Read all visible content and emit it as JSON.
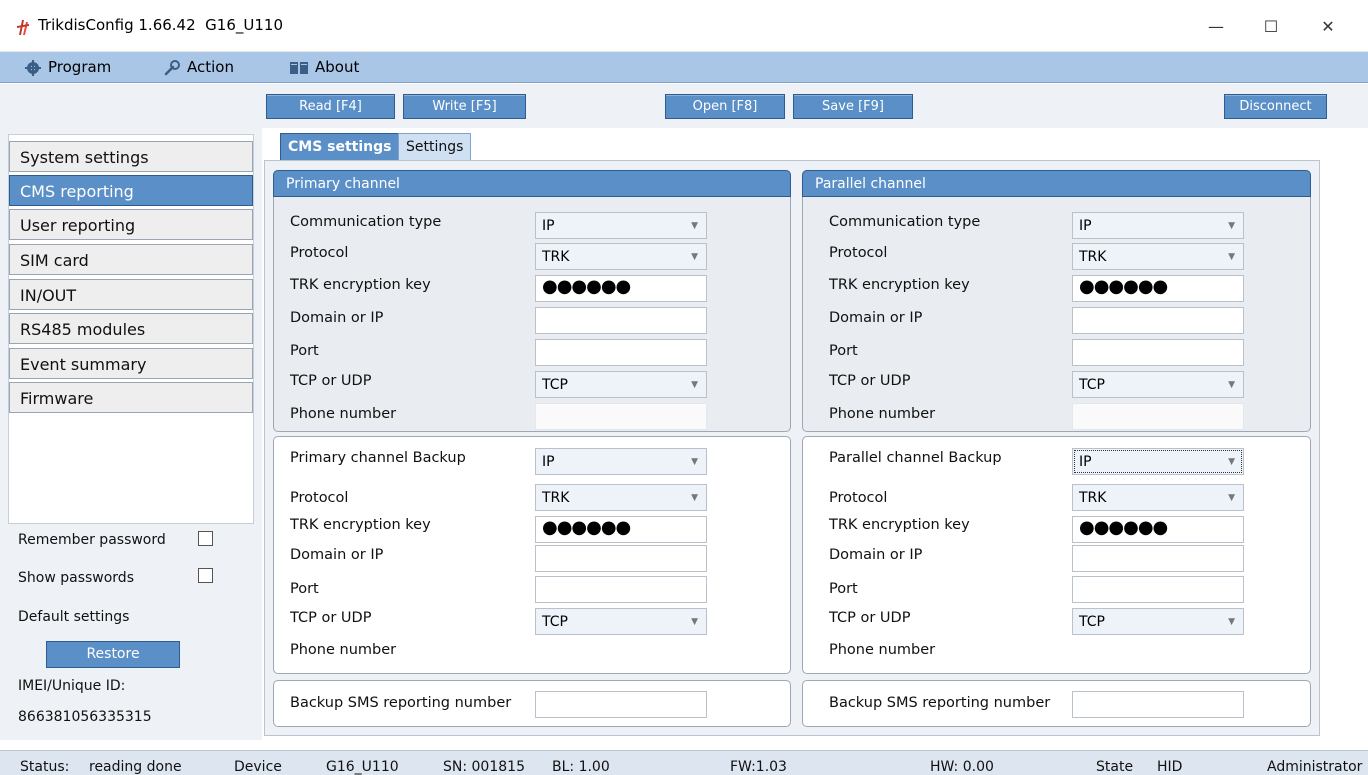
{
  "window": {
    "title": "TrikdisConfig 1.66.42  G16_U110",
    "minimize": "—",
    "maximize": "☐",
    "close": "✕"
  },
  "menu": {
    "program": "Program",
    "action": "Action",
    "about": "About"
  },
  "toolbar": {
    "read": "Read [F4]",
    "write": "Write [F5]",
    "open": "Open [F8]",
    "save": "Save [F9]",
    "disconnect": "Disconnect"
  },
  "sidebar": {
    "items": [
      {
        "label": "System settings"
      },
      {
        "label": "CMS reporting"
      },
      {
        "label": "User reporting"
      },
      {
        "label": "SIM card"
      },
      {
        "label": "IN/OUT"
      },
      {
        "label": "RS485 modules"
      },
      {
        "label": "Event summary"
      },
      {
        "label": "Firmware"
      }
    ],
    "active_index": 1,
    "remember_password": "Remember password",
    "show_passwords": "Show passwords",
    "default_settings": "Default settings",
    "restore": "Restore",
    "imei_label": "IMEI/Unique ID:",
    "imei_value": "866381056335315"
  },
  "tabs": {
    "cms_settings": "CMS settings",
    "settings": "Settings"
  },
  "primary": {
    "header": "Primary channel",
    "comm_type_label": "Communication type",
    "comm_type_value": "IP",
    "protocol_label": "Protocol",
    "protocol_value": "TRK",
    "key_label": "TRK encryption key",
    "key_value": "●●●●●●",
    "domain_label": "Domain or IP",
    "domain_value": "",
    "port_label": "Port",
    "port_value": "",
    "tcpudp_label": "TCP or UDP",
    "tcpudp_value": "TCP",
    "phone_label": "Phone number",
    "phone_value": ""
  },
  "parallel": {
    "header": "Parallel channel",
    "comm_type_label": "Communication type",
    "comm_type_value": "IP",
    "protocol_label": "Protocol",
    "protocol_value": "TRK",
    "key_label": "TRK encryption key",
    "key_value": "●●●●●●",
    "domain_label": "Domain or IP",
    "domain_value": "",
    "port_label": "Port",
    "port_value": "",
    "tcpudp_label": "TCP or UDP",
    "tcpudp_value": "TCP",
    "phone_label": "Phone number",
    "phone_value": ""
  },
  "primary_backup": {
    "backup_label": "Primary channel Backup",
    "backup_value": "IP",
    "protocol_label": "Protocol",
    "protocol_value": "TRK",
    "key_label": "TRK encryption key",
    "key_value": "●●●●●●",
    "domain_label": "Domain or IP",
    "domain_value": "",
    "port_label": "Port",
    "port_value": "",
    "tcpudp_label": "TCP or UDP",
    "tcpudp_value": "TCP",
    "phone_label": "Phone number"
  },
  "parallel_backup": {
    "backup_label": "Parallel channel Backup",
    "backup_value": "IP",
    "protocol_label": "Protocol",
    "protocol_value": "TRK",
    "key_label": "TRK encryption key",
    "key_value": "●●●●●●",
    "domain_label": "Domain or IP",
    "domain_value": "",
    "port_label": "Port",
    "port_value": "",
    "tcpudp_label": "TCP or UDP",
    "tcpudp_value": "TCP",
    "phone_label": "Phone number"
  },
  "sms": {
    "left_label": "Backup SMS reporting number",
    "left_value": "",
    "right_label": "Backup SMS reporting number",
    "right_value": ""
  },
  "status": {
    "status_label": "Status:",
    "status_value": "reading done",
    "device_label": "Device",
    "device_value": "G16_U110",
    "sn": "SN: 001815",
    "bl": "BL: 1.00",
    "fw": "FW:1.03",
    "hw": "HW:  0.00",
    "state_label": "State",
    "state_value": "HID",
    "role": "Administrator"
  },
  "colors": {
    "accent": "#5b8fc7",
    "menubar": "#a9c6e6",
    "panel": "#eef2f7"
  },
  "icons": {
    "app": "trikdis-logo-icon",
    "program": "gear-icon",
    "action": "wrench-icon",
    "about": "book-icon"
  }
}
